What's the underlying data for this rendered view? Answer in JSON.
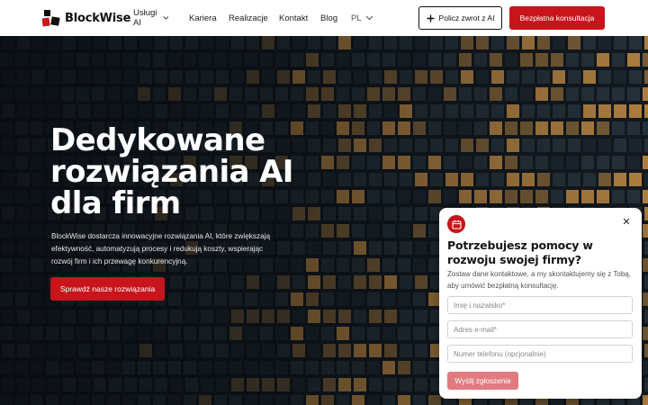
{
  "brand": {
    "name": "BlockWise",
    "color_red": "#c8141b",
    "color_dark": "#111111"
  },
  "nav": {
    "items": [
      {
        "label": "Usługi AI",
        "has_dropdown": true
      },
      {
        "label": "Kariera",
        "has_dropdown": false
      },
      {
        "label": "Realizacje",
        "has_dropdown": false
      },
      {
        "label": "Kontakt",
        "has_dropdown": false
      },
      {
        "label": "Blog",
        "has_dropdown": false
      },
      {
        "label": "PL",
        "has_dropdown": true
      }
    ]
  },
  "header_buttons": {
    "refund_label": "Policz zwrot z AI",
    "refund_icon": "plus-icon",
    "consult_label": "Bezpłatna konsultacja"
  },
  "hero": {
    "title_line1": "Dedykowane",
    "title_line2": "rozwiązania AI",
    "title_line3": "dla firm",
    "description": "BlockWise dostarcza innowacyjne rozwiązania AI, które zwiększają efektywność, automatyzują procesy i redukują koszty, wspierając rozwój firm i ich przewagę konkurencyjną.",
    "cta_label": "Sprawdź nasze rozwiązania",
    "background": "night office building facade with lit windows"
  },
  "widget": {
    "icon": "calendar-icon",
    "close_icon": "close-icon",
    "title": "Potrzebujesz pomocy w rozwoju swojej firmy?",
    "description": "Zostaw dane kontaktowe, a my skontaktujemy się z Tobą, aby umówić bezpłatną konsultację.",
    "name_placeholder": "Imię i nazwisko*",
    "email_placeholder": "Adres e-mail*",
    "phone_placeholder": "Numer telefonu (opcjonalnie)",
    "submit_label": "Wyślij zgłoszenie",
    "submit_color": "#e07c80"
  }
}
